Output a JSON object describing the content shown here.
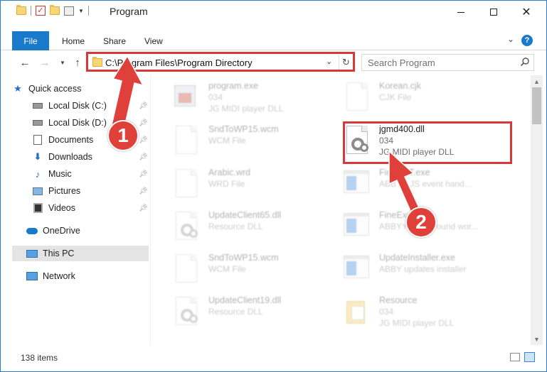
{
  "window": {
    "title": "Program",
    "minimize_label": "",
    "maximize_label": "",
    "close_label": "✕"
  },
  "ribbon": {
    "file_tab": "File",
    "tabs": [
      "Home",
      "Share",
      "View"
    ],
    "help": "?"
  },
  "address_bar": {
    "path": "C:\\Program Files\\Program Directory"
  },
  "search": {
    "placeholder": "Search Program"
  },
  "sidebar": {
    "items": [
      {
        "label": "Quick access",
        "icon": "star-icon"
      },
      {
        "label": "Local Disk (C:)",
        "icon": "drive-icon",
        "pinned": true
      },
      {
        "label": "Local Disk (D:)",
        "icon": "drive-icon",
        "pinned": true
      },
      {
        "label": "Documents",
        "icon": "documents-icon",
        "pinned": true
      },
      {
        "label": "Downloads",
        "icon": "downloads-icon",
        "pinned": true
      },
      {
        "label": "Music",
        "icon": "music-icon",
        "pinned": true
      },
      {
        "label": "Pictures",
        "icon": "pictures-icon",
        "pinned": true
      },
      {
        "label": "Videos",
        "icon": "videos-icon",
        "pinned": true
      },
      {
        "label": "OneDrive",
        "icon": "onedrive-icon"
      },
      {
        "label": "This PC",
        "icon": "this-pc-icon",
        "selected": true
      },
      {
        "label": "Network",
        "icon": "network-icon"
      }
    ]
  },
  "files": [
    {
      "name": "program.exe",
      "line2": "034",
      "line3": "JG MIDI player DLL",
      "icon": "exe-icon"
    },
    {
      "name": "Korean.cjk",
      "line2": "CJK File",
      "line3": "",
      "icon": "file-icon"
    },
    {
      "name": "SndToWP15.wcm",
      "line2": "WCM File",
      "line3": "",
      "icon": "file-icon"
    },
    {
      "name": "jgmd400.dll",
      "line2": "034",
      "line3": "JG MIDI player DLL",
      "icon": "dll-gear-icon"
    },
    {
      "name": "Arabic.wrd",
      "line2": "WRD File",
      "line3": "",
      "icon": "file-icon"
    },
    {
      "name": "FinalyST.exe",
      "line2": "ABBYY JS event hand...",
      "line3": "",
      "icon": "app-window-icon"
    },
    {
      "name": "UpdateClient65.dll",
      "line2": "Resource DLL",
      "line3": "",
      "icon": "dll-gear-icon"
    },
    {
      "name": "FineExec.exe",
      "line2": "ABBYY Background wor...",
      "line3": "",
      "icon": "app-window-icon"
    },
    {
      "name": "SndToWP15.wcm",
      "line2": "WCM File",
      "line3": "",
      "icon": "file-icon"
    },
    {
      "name": "UpdateInstaller.exe",
      "line2": "ABBY updates installer",
      "line3": "",
      "icon": "app-window-icon"
    },
    {
      "name": "UpdateClient19.dll",
      "line2": "Resource DLL",
      "line3": "",
      "icon": "dll-gear-icon"
    },
    {
      "name": "Resource",
      "line2": "034",
      "line3": "JG MIDI player DLL",
      "icon": "resource-folder-icon"
    }
  ],
  "status": {
    "item_count": "138 items"
  },
  "annotations": {
    "badge1": "1",
    "badge2": "2",
    "color": "#e0403a"
  }
}
